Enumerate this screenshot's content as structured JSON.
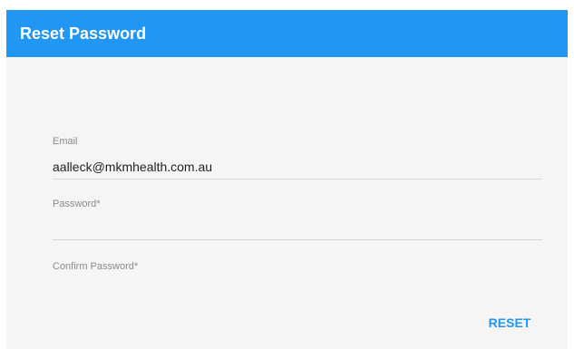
{
  "dialog": {
    "title": "Reset Password"
  },
  "form": {
    "email": {
      "label": "Email",
      "value": "aalleck@mkmhealth.com.au"
    },
    "password": {
      "label": "Password*",
      "value": ""
    },
    "confirm_password": {
      "label": "Confirm Password*",
      "value": ""
    }
  },
  "actions": {
    "reset_label": "RESET"
  },
  "colors": {
    "header_background": "#2196f3",
    "accent": "#2196f3",
    "dialog_background": "#f5f5f5"
  }
}
